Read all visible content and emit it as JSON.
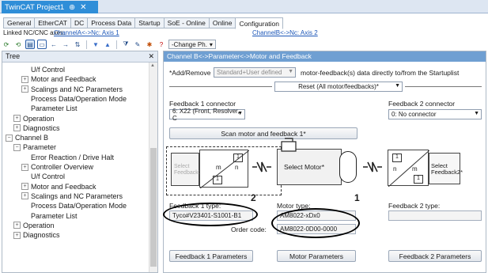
{
  "document_tab": {
    "title": "TwinCAT Project1",
    "pin": "⊕",
    "close": "✕"
  },
  "config_tabs": [
    "General",
    "EtherCAT",
    "DC",
    "Process Data",
    "Startup",
    "SoE - Online",
    "Online",
    "Configuration"
  ],
  "links": {
    "label": "Linked NC/CNC axes:",
    "axis_a": "ChannelA<->Nc: Axis 1",
    "axis_b": "ChannelB<->Nc: Axis 2"
  },
  "toolbar": {
    "combo_label": "-Change Ph.",
    "question": "?"
  },
  "tree": {
    "header": "Tree",
    "items": [
      {
        "label": "U/f Control",
        "indent": 2,
        "twisty": ""
      },
      {
        "label": "Motor and Feedback",
        "indent": 2,
        "twisty": "+"
      },
      {
        "label": "Scalings and NC Parameters",
        "indent": 2,
        "twisty": "+"
      },
      {
        "label": "Process Data/Operation Mode",
        "indent": 2,
        "twisty": ""
      },
      {
        "label": "Parameter List",
        "indent": 2,
        "twisty": ""
      },
      {
        "label": "Operation",
        "indent": 1,
        "twisty": "+"
      },
      {
        "label": "Diagnostics",
        "indent": 1,
        "twisty": "+"
      },
      {
        "label": "Channel B",
        "indent": 0,
        "twisty": "−"
      },
      {
        "label": "Parameter",
        "indent": 1,
        "twisty": "−"
      },
      {
        "label": "Error Reaction / Drive Halt",
        "indent": 2,
        "twisty": ""
      },
      {
        "label": "Controller Overview",
        "indent": 2,
        "twisty": "+"
      },
      {
        "label": "U/f Control",
        "indent": 2,
        "twisty": ""
      },
      {
        "label": "Motor and Feedback",
        "indent": 2,
        "twisty": "+"
      },
      {
        "label": "Scalings and NC Parameters",
        "indent": 2,
        "twisty": "+"
      },
      {
        "label": "Process Data/Operation Mode",
        "indent": 2,
        "twisty": ""
      },
      {
        "label": "Parameter List",
        "indent": 2,
        "twisty": ""
      },
      {
        "label": "Operation",
        "indent": 1,
        "twisty": "+"
      },
      {
        "label": "Diagnostics",
        "indent": 1,
        "twisty": "+"
      }
    ]
  },
  "panel": {
    "header": "Channel B<->Parameter<->Motor and Feedback",
    "add_remove_label": "*Add/Remove",
    "add_remove_value": "Standard+User defined",
    "add_remove_desc": "motor-feedback(s) data directly to/from the Startuplist",
    "reset_button": "Reset (All motor/feedbacks)*",
    "fb1_connector_label": "Feedback 1 connector",
    "fb1_connector_value": "6: X22 (Front, Resolver, C",
    "fb2_connector_label": "Feedback 2 connector",
    "fb2_connector_value": "0: No connector",
    "scan_button": "Scan motor and feedback 1*",
    "select_feedback1": "Select Feedback1*",
    "select_motor": "Select Motor*",
    "select_feedback2": "Select Feedback2*",
    "gear_m": "m",
    "gear_n": "n",
    "gear_1": "1",
    "fb1_type_label": "Feedback 1 type:",
    "fb1_type_value": "Tyco#V23401-S1001-B1",
    "motor_type_label": "Motor type:",
    "motor_type_value": "AM8022-xDx0",
    "order_code_label": "Order code:",
    "order_code_value": "AM8022-0D00-0000",
    "fb2_type_label": "Feedback 2 type:",
    "fb2_type_value": "",
    "fb1_params_button": "Feedback 1 Parameters",
    "motor_params_button": "Motor Parameters",
    "fb2_params_button": "Feedback 2 Parameters",
    "callout_2": "2",
    "callout_1": "1"
  }
}
